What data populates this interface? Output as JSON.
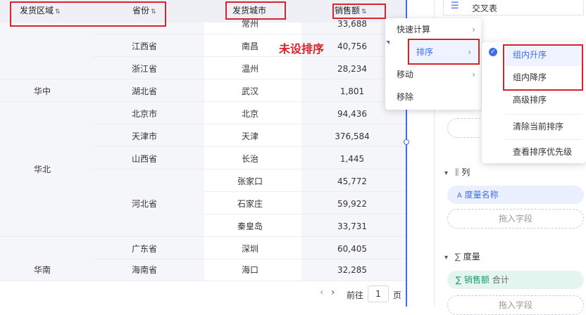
{
  "table": {
    "headers": {
      "region": "发货区域",
      "province": "省份",
      "city": "发货城市",
      "sales": "销售额"
    },
    "sort_glyph": "⇅",
    "rows": [
      {
        "city": "常州",
        "sales": "33,688"
      },
      {
        "province": "江西省",
        "city": "南昌",
        "sales": "40,756"
      },
      {
        "province": "浙江省",
        "city": "温州",
        "sales": "28,234"
      },
      {
        "region": "华中",
        "province": "湖北省",
        "city": "武汉",
        "sales": "1,801"
      },
      {
        "province": "北京市",
        "city": "北京",
        "sales": "94,436"
      },
      {
        "province": "天津市",
        "city": "天津",
        "sales": "376,584"
      },
      {
        "province": "山西省",
        "city": "长治",
        "sales": "1,445"
      },
      {
        "city": "张家口",
        "sales": "45,772"
      },
      {
        "province": "河北省",
        "city": "石家庄",
        "sales": "59,922"
      },
      {
        "city": "秦皇岛",
        "sales": "33,731"
      },
      {
        "province": "广东省",
        "city": "深圳",
        "sales": "60,405"
      },
      {
        "province": "海南省",
        "city": "海口",
        "sales": "32,285"
      }
    ],
    "regions": {
      "huabei": "华北",
      "huanan": "华南"
    }
  },
  "annotation": "未设排序",
  "pager": {
    "goto_label": "前往",
    "page_value": "1",
    "page_suffix": "页"
  },
  "context_menu": {
    "items": [
      "快速计算",
      "排序",
      "移动",
      "移除"
    ]
  },
  "sort_submenu": {
    "items": [
      "组内升序",
      "组内降序",
      "高级排序",
      "清除当前排序",
      "查看排序优先级"
    ]
  },
  "panel": {
    "top_item": "交叉表",
    "columns_label": "列",
    "columns_chip": "度量名称",
    "drop_hint": "拖入字段",
    "measures_label": "度量",
    "measure_chip": "销售额",
    "measure_agg": "合计",
    "drop_hint2": "拖入字段"
  },
  "colors": {
    "accent": "#3d6ee8",
    "annotation_red": "#d9232c"
  }
}
